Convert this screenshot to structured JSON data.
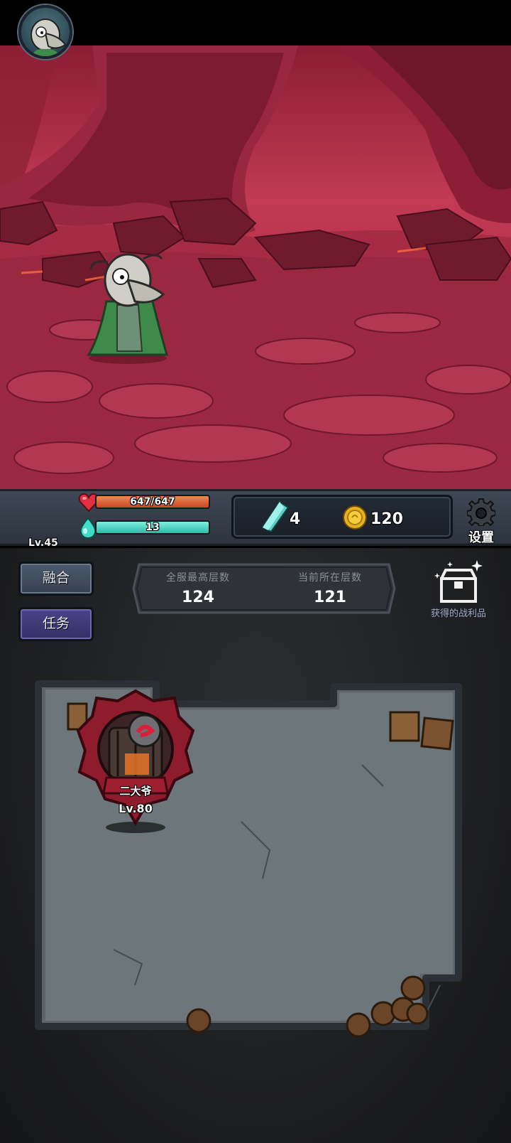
{
  "player": {
    "level": "Lv.45",
    "hp_text": "647/647",
    "hp_fraction": 1.0,
    "mp_text": "13",
    "mp_fraction": 1.0
  },
  "currency": {
    "gems": "4",
    "coins": "120"
  },
  "settings_label": "设置",
  "buttons": {
    "fuse": "融合",
    "tasks": "任务"
  },
  "floors": {
    "server_highest_label": "全服最高层数",
    "server_highest_value": "124",
    "current_label": "当前所在层数",
    "current_value": "121"
  },
  "loot_label": "获得的战利品",
  "boss": {
    "name": "二大爷",
    "level": "Lv.80"
  },
  "colors": {
    "hp_fill": "#e0643a",
    "mp_fill": "#4fd6c4",
    "scene_red": "#b8324d",
    "task_button": "#4a4486",
    "fuse_button": "#4c5a6c"
  }
}
